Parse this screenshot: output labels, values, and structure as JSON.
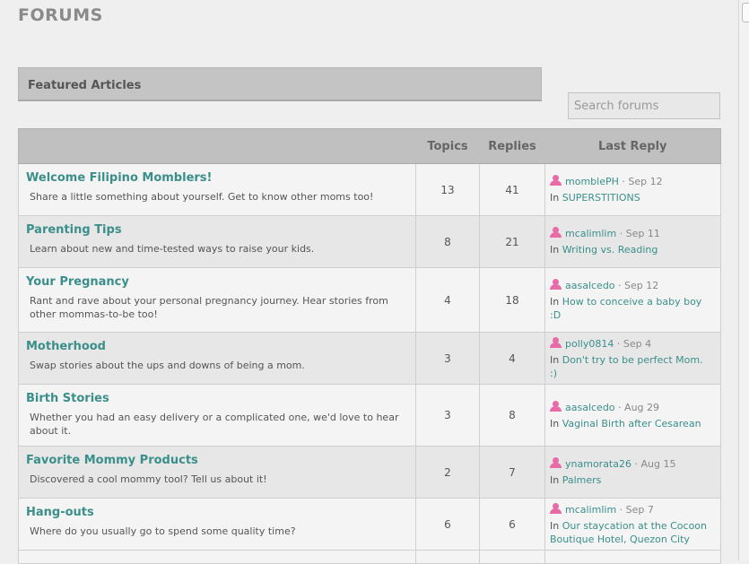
{
  "page": {
    "title": "FORUMS",
    "featured_label": "Featured Articles",
    "search_placeholder": "Search forums"
  },
  "table": {
    "headers": {
      "forum": "",
      "topics": "Topics",
      "replies": "Replies",
      "last_reply": "Last Reply"
    },
    "date_separator": " · ",
    "in_label": "In ",
    "rows": [
      {
        "name": "Welcome Filipino Momblers!",
        "description": "Share a little something about yourself. Get to know other moms too!",
        "topics": "13",
        "replies": "41",
        "last_user": "momblePH",
        "last_date": "Sep 12",
        "last_topic": "SUPERSTITIONS"
      },
      {
        "name": "Parenting Tips",
        "description": "Learn about new and time-tested ways to raise your kids.",
        "topics": "8",
        "replies": "21",
        "last_user": "mcalimlim",
        "last_date": "Sep 11",
        "last_topic": "Writing vs. Reading"
      },
      {
        "name": "Your Pregnancy",
        "description": "Rant and rave about your personal pregnancy journey. Hear stories from other mommas-to-be too!",
        "topics": "4",
        "replies": "18",
        "last_user": "aasalcedo",
        "last_date": "Sep 12",
        "last_topic": "How to conceive a baby boy :D"
      },
      {
        "name": "Motherhood",
        "description": "Swap stories about the ups and downs of being a mom.",
        "topics": "3",
        "replies": "4",
        "last_user": "polly0814",
        "last_date": "Sep 4",
        "last_topic": "Don't try to be perfect Mom. :)"
      },
      {
        "name": "Birth Stories",
        "description": "Whether you had an easy delivery or a complicated one, we'd love to hear about it.",
        "topics": "3",
        "replies": "8",
        "last_user": "aasalcedo",
        "last_date": "Aug 29",
        "last_topic": "Vaginal Birth after Cesarean"
      },
      {
        "name": "Favorite Mommy Products",
        "description": "Discovered a cool mommy tool? Tell us about it!",
        "topics": "2",
        "replies": "7",
        "last_user": "ynamorata26",
        "last_date": "Aug 15",
        "last_topic": "Palmers"
      },
      {
        "name": "Hang-outs",
        "description": "Where do you usually go to spend some quality time?",
        "topics": "6",
        "replies": "6",
        "last_user": "mcalimlim",
        "last_date": "Sep 7",
        "last_topic": "Our staycation at the Cocoon Boutique Hotel, Quezon City"
      }
    ]
  },
  "colors": {
    "link": "#3a8f8b",
    "user_icon": "#e86aa7",
    "header_bg": "#c0c0c0"
  },
  "icons": {
    "user": "user-icon"
  }
}
